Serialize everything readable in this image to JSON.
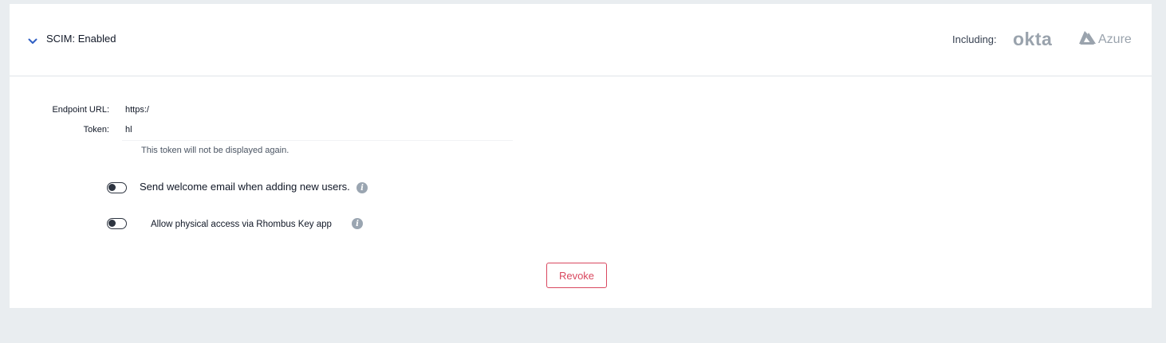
{
  "header": {
    "title": "SCIM: Enabled",
    "including_label": "Including:",
    "providers": {
      "okta": "okta",
      "azure": "Azure"
    }
  },
  "fields": {
    "endpoint": {
      "label": "Endpoint URL:",
      "value": "https:/"
    },
    "token": {
      "label": "Token:",
      "value": "hl"
    },
    "token_note": "This token will not be displayed again."
  },
  "toggles": [
    {
      "label": "Send welcome email when adding new users.",
      "enabled": false
    },
    {
      "label": "Allow physical access via Rhombus Key app",
      "enabled": false
    }
  ],
  "actions": {
    "revoke_label": "Revoke"
  },
  "colors": {
    "accent": "#2f5fc4",
    "danger": "#d9485f",
    "logo_gray": "#9aa3ad",
    "page_bg": "#e9edf0"
  },
  "icons": {
    "collapse": "chevron-down-icon",
    "info": "info-icon",
    "azure_logo": "azure-logo-icon"
  }
}
